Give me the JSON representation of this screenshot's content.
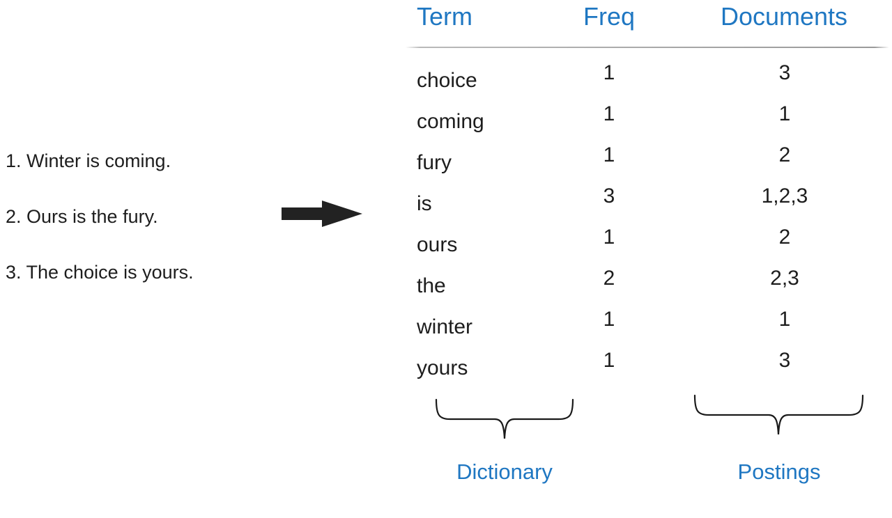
{
  "colors": {
    "accent_blue": "#1F77C2",
    "text_black": "#1D1D1D",
    "rule_gray": "#A9A9A9",
    "arrow_black": "#222222"
  },
  "documents": {
    "name": "source-documents",
    "lines": [
      "1. Winter is coming.",
      "2. Ours is the fury.",
      "3. The choice is yours."
    ]
  },
  "arrow": {
    "icon": "right-arrow-icon",
    "direction": "right"
  },
  "index_table": {
    "headers": {
      "term": "Term",
      "freq": "Freq",
      "documents": "Documents"
    },
    "rows": [
      {
        "term": "choice",
        "freq": "1",
        "documents": "3"
      },
      {
        "term": "coming",
        "freq": "1",
        "documents": "1"
      },
      {
        "term": "fury",
        "freq": "1",
        "documents": "2"
      },
      {
        "term": "is",
        "freq": "3",
        "documents": "1,2,3"
      },
      {
        "term": "ours",
        "freq": "1",
        "documents": "2"
      },
      {
        "term": "the",
        "freq": "2",
        "documents": "2,3"
      },
      {
        "term": "winter",
        "freq": "1",
        "documents": "1"
      },
      {
        "term": "yours",
        "freq": "1",
        "documents": "3"
      }
    ]
  },
  "groups": {
    "dictionary_label": "Dictionary",
    "postings_label": "Postings"
  }
}
